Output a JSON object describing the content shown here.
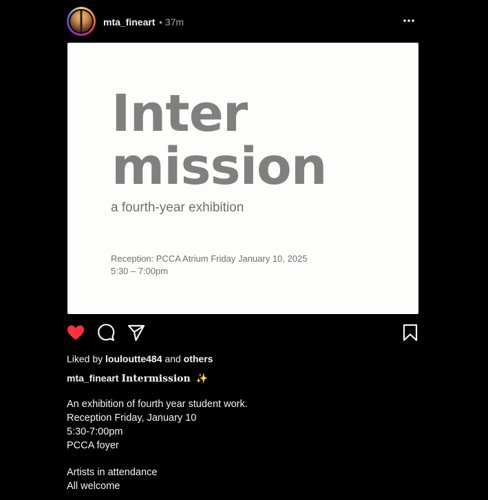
{
  "post": {
    "username": "mta_fineart",
    "time": "• 37m",
    "image": {
      "title_line1": "Inter",
      "title_line2": "mission",
      "subtitle": "a fourth-year exhibition",
      "reception_line1": "Reception: PCCA Atrium Friday January 10, 2025",
      "reception_line2": "5:30 – 7:00pm"
    },
    "likes": {
      "prefix": "Liked by",
      "user": "louloutte484",
      "and": "and",
      "others": "others"
    },
    "caption": {
      "username": "mta_fineart",
      "title": "𝐈𝐧𝐭𝐞𝐫𝐦𝐢𝐬𝐬𝐢𝐨𝐧",
      "emoji": "✨",
      "lines": [
        "An exhibition of fourth year student work.",
        "Reception Friday, January 10",
        "5:30-7:00pm",
        "PCCA foyer",
        "Artists in attendance",
        "All welcome"
      ]
    },
    "icons": [
      "more-icon",
      "heart-icon",
      "comment-icon",
      "share-icon",
      "bookmark-icon"
    ],
    "colors": {
      "like_red": "#ff3040",
      "background": "#000000",
      "muted": "#a8a8a8"
    }
  }
}
